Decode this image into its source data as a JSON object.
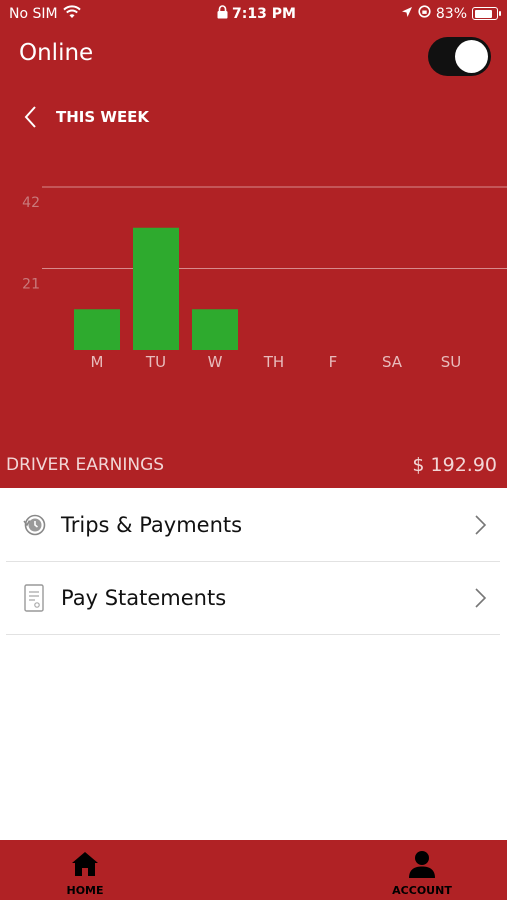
{
  "status_bar": {
    "carrier": "No SIM",
    "time": "7:13 PM",
    "battery": "83%",
    "battery_level": 0.83
  },
  "header": {
    "title": "Online",
    "online_toggle_on": true,
    "period_label": "THIS WEEK"
  },
  "chart_data": {
    "type": "bar",
    "categories": [
      "M",
      "TU",
      "W",
      "TH",
      "F",
      "SA",
      "SU"
    ],
    "values": [
      10.5,
      31.5,
      10.5,
      0,
      0,
      0,
      0
    ],
    "ytick_labels": [
      "42",
      "21"
    ],
    "yticks": [
      42,
      21
    ],
    "ylim": [
      0,
      42
    ],
    "grid": true,
    "colors": {
      "bar": "#2eaa2e",
      "grid": "#d88a8c",
      "tick": "#e8bcbc",
      "axis_label": "#c97a7c"
    }
  },
  "earnings": {
    "label": "DRIVER EARNINGS",
    "amount": "$ 192.90"
  },
  "menu": {
    "items": [
      {
        "label": "Trips & Payments",
        "icon": "history-clock-icon"
      },
      {
        "label": "Pay Statements",
        "icon": "receipt-icon"
      }
    ]
  },
  "tabbar": {
    "tabs": [
      {
        "label": "HOME",
        "icon": "home-icon"
      },
      {
        "label": "ACCOUNT",
        "icon": "person-icon"
      }
    ]
  },
  "colors": {
    "brand_red": "#b02225",
    "toggle_track": "#111111"
  }
}
